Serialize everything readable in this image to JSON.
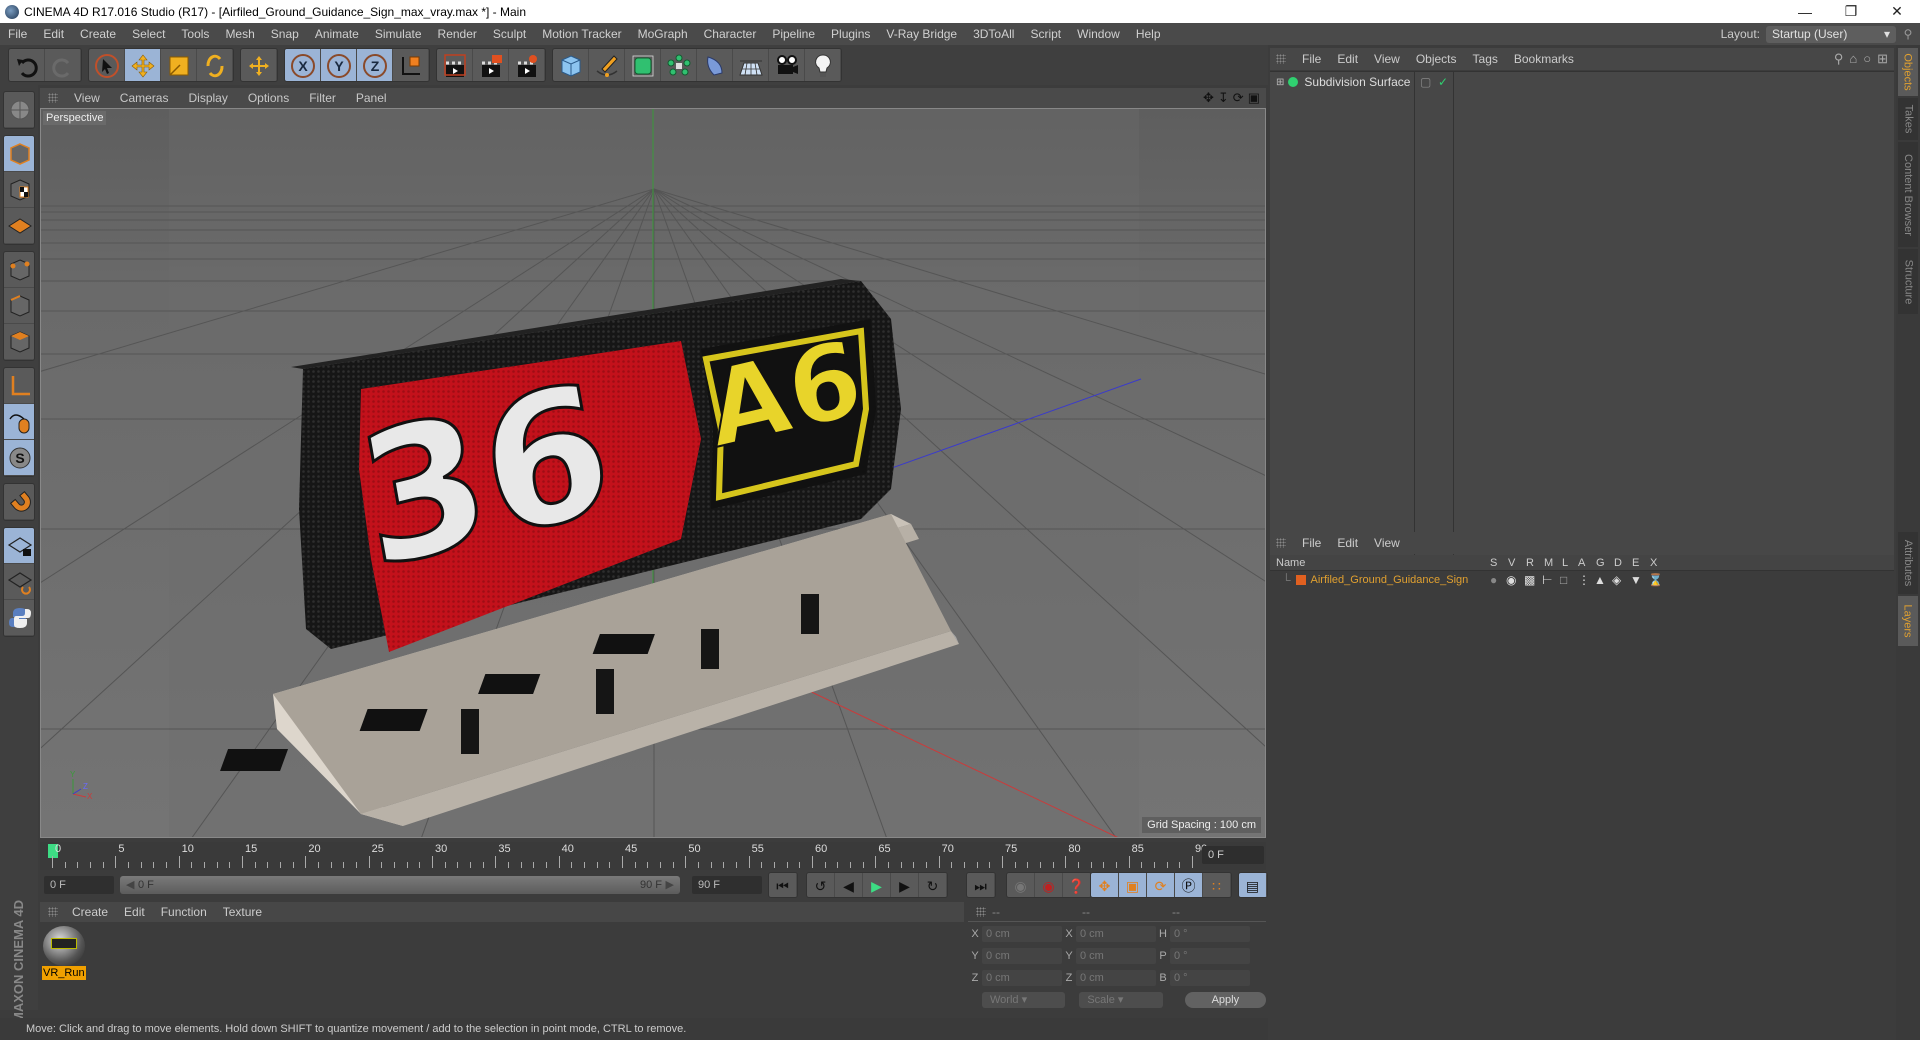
{
  "window": {
    "title": "CINEMA 4D R17.016 Studio (R17) - [Airfiled_Ground_Guidance_Sign_max_vray.max *] - Main",
    "controls": [
      "minimize",
      "restore",
      "close"
    ]
  },
  "menubar": {
    "items": [
      "File",
      "Edit",
      "Create",
      "Select",
      "Tools",
      "Mesh",
      "Snap",
      "Animate",
      "Simulate",
      "Render",
      "Sculpt",
      "Motion Tracker",
      "MoGraph",
      "Character",
      "Pipeline",
      "Plugins",
      "V-Ray Bridge",
      "3DToAll",
      "Script",
      "Window",
      "Help"
    ],
    "layout_label": "Layout:",
    "layout_value": "Startup (User)"
  },
  "toolbar": {
    "groups": [
      [
        "undo-icon",
        "redo-icon"
      ],
      [
        "live-selection-icon",
        "move-icon",
        "scale-icon",
        "rotate-icon"
      ],
      [
        "recent-tool-icon"
      ],
      [
        "x-axis-icon",
        "y-axis-icon",
        "z-axis-icon",
        "world-coord-icon"
      ],
      [
        "render-view-icon",
        "render-picture-viewer-icon",
        "render-settings-icon"
      ],
      [
        "cube-icon",
        "pen-spline-icon",
        "subdivision-icon",
        "mograph-cloner-icon",
        "deformer-icon",
        "floor-icon",
        "camera-icon",
        "light-icon"
      ]
    ]
  },
  "left_toolbar": {
    "items": [
      "make-editable-icon",
      "model-mode-icon",
      "texture-mode-icon",
      "workplane-mode-icon",
      "points-mode-icon",
      "edges-mode-icon",
      "polygons-mode-icon",
      "axis-mode-icon",
      "tweak-mode-icon",
      "solo-icon",
      "snap-icon",
      "locked-workplane-icon",
      "planar-workplane-icon",
      "python-icon"
    ]
  },
  "viewport": {
    "menu": [
      "View",
      "Cameras",
      "Display",
      "Options",
      "Filter",
      "Panel"
    ],
    "camera_label": "Perspective",
    "grid_spacing": "Grid Spacing : 100 cm",
    "sign_left_text": "36",
    "sign_right_text": "A6"
  },
  "timeline": {
    "ticks": [
      "0",
      "5",
      "10",
      "15",
      "20",
      "25",
      "30",
      "35",
      "40",
      "45",
      "50",
      "55",
      "60",
      "65",
      "70",
      "75",
      "80",
      "85",
      "90"
    ],
    "current_frame": "0 F",
    "start_field": "0 F",
    "slider_start": "0 F",
    "slider_end": "90 F",
    "end_field": "90 F"
  },
  "material_manager": {
    "menu": [
      "Create",
      "Edit",
      "Function",
      "Texture"
    ],
    "materials": [
      {
        "name": "VR_Run"
      }
    ]
  },
  "coordinates": {
    "headers": [
      "--",
      "--",
      "--"
    ],
    "rows": [
      {
        "l1": "X",
        "v1": "0 cm",
        "l2": "X",
        "v2": "0 cm",
        "l3": "H",
        "v3": "0 °"
      },
      {
        "l1": "Y",
        "v1": "0 cm",
        "l2": "Y",
        "v2": "0 cm",
        "l3": "P",
        "v3": "0 °"
      },
      {
        "l1": "Z",
        "v1": "0 cm",
        "l2": "Z",
        "v2": "0 cm",
        "l3": "B",
        "v3": "0 °"
      }
    ],
    "mode_dropdown": "World",
    "type_dropdown": "Scale",
    "apply_label": "Apply"
  },
  "object_manager": {
    "menu": [
      "File",
      "Edit",
      "View",
      "Objects",
      "Tags",
      "Bookmarks"
    ],
    "objects": [
      {
        "name": "Subdivision Surface",
        "color": "#30d070"
      }
    ]
  },
  "layer_manager": {
    "menu": [
      "File",
      "Edit",
      "View"
    ],
    "columns": [
      "Name",
      "S",
      "V",
      "R",
      "M",
      "L",
      "A",
      "G",
      "D",
      "E",
      "X"
    ],
    "layers": [
      {
        "name": "Airfiled_Ground_Guidance_Sign",
        "color": "#e06020"
      }
    ]
  },
  "side_tabs": {
    "top": [
      {
        "label": "Objects",
        "active": true
      },
      {
        "label": "Takes",
        "active": false
      },
      {
        "label": "Content Browser",
        "active": false
      },
      {
        "label": "Structure",
        "active": false
      }
    ],
    "bottom": [
      {
        "label": "Attributes",
        "active": false
      },
      {
        "label": "Layers",
        "active": true
      }
    ]
  },
  "brand": {
    "logo": "MAXON CINEMA 4D"
  },
  "statusbar": {
    "text": "Move: Click and drag to move elements. Hold down SHIFT to quantize movement / add to the selection in point mode, CTRL to remove."
  },
  "colors": {
    "accent": "#9bb4d6",
    "highlight": "#f0a000",
    "layer_text": "#e0a030"
  }
}
